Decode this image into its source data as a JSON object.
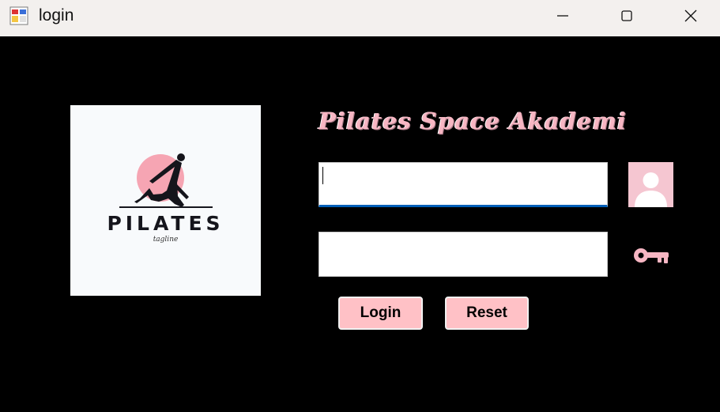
{
  "window": {
    "title": "login",
    "controls": {
      "minimize": "minimize-icon",
      "maximize": "maximize-icon",
      "close": "close-icon"
    }
  },
  "logo": {
    "word": "PILATES",
    "tagline": "tagline",
    "circle_color": "#f6a5b3"
  },
  "form": {
    "heading": "Pilates Space Akademi",
    "username": {
      "value": "",
      "placeholder": ""
    },
    "password": {
      "value": "",
      "placeholder": ""
    },
    "user_icon": "user-avatar-icon",
    "key_icon": "key-icon"
  },
  "buttons": {
    "login": "Login",
    "reset": "Reset"
  },
  "colors": {
    "background": "#000000",
    "accent_pink": "#f7b6c3",
    "button_pink": "#ffc1c6",
    "focus_blue": "#005fb8"
  }
}
